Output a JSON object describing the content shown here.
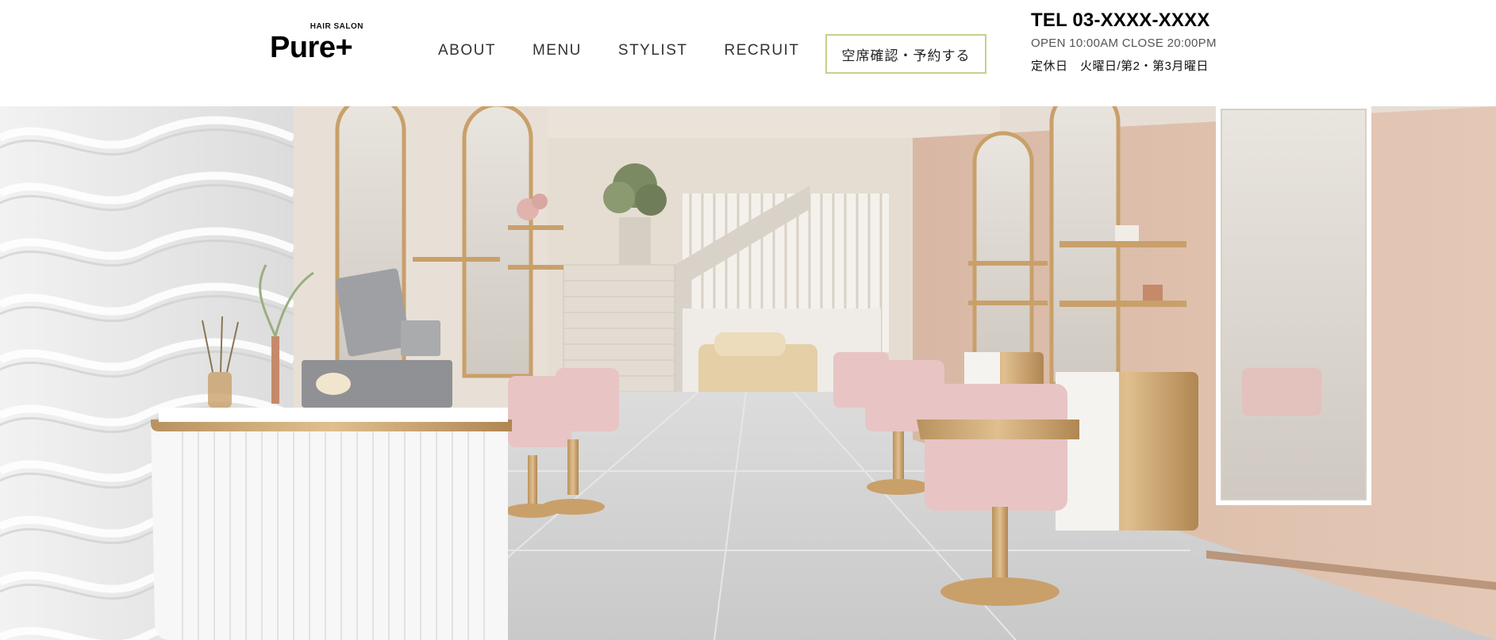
{
  "logo": {
    "sub": "HAIR SALON",
    "main": "Pure+"
  },
  "nav": [
    {
      "label": "ABOUT"
    },
    {
      "label": "MENU"
    },
    {
      "label": "STYLIST"
    },
    {
      "label": "RECRUIT"
    }
  ],
  "reserve": {
    "label": "空席確認・予約する",
    "border_color": "#c6cf8a"
  },
  "info": {
    "tel": "TEL 03-XXXX-XXXX",
    "hours": "OPEN 10:00AM CLOSE 20:00PM",
    "holiday": "定休日　火曜日/第2・第3月曜日"
  },
  "colors": {
    "brand_text": "#000000",
    "accent_border": "#c6cf8a",
    "wall_pink": "#d9b9a6",
    "chair_pink": "#e8c4c4",
    "gold": "#c9a06a",
    "floor": "#d4d4d4"
  }
}
